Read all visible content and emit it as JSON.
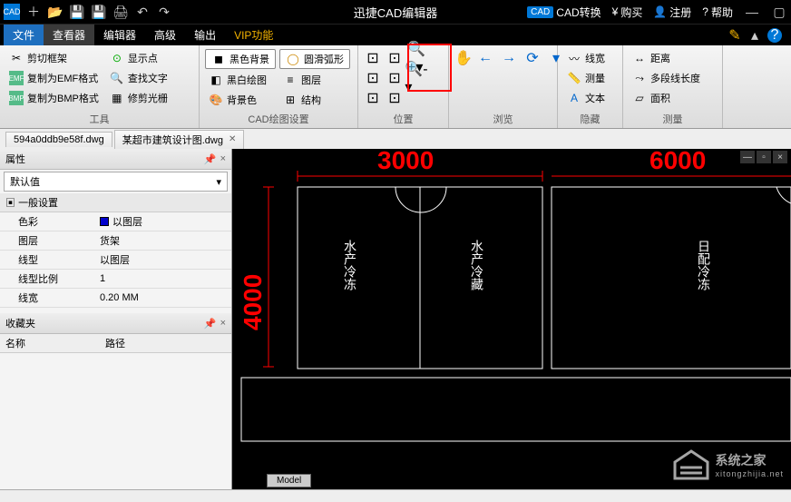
{
  "titlebar": {
    "app_title": "迅捷CAD编辑器",
    "right": {
      "convert": "CAD转换",
      "buy": "购买",
      "register": "注册",
      "help": "帮助"
    }
  },
  "menubar": {
    "tabs": [
      "文件",
      "查看器",
      "编辑器",
      "高级",
      "输出",
      "VIP功能"
    ],
    "active_index": 1
  },
  "ribbon": {
    "groups": {
      "tools": {
        "label": "工具",
        "items": [
          "剪切框架",
          "复制为EMF格式",
          "复制为BMP格式",
          "显示点",
          "查找文字",
          "修剪光栅"
        ]
      },
      "cad_draw": {
        "label": "CAD绘图设置",
        "items": [
          "黑色背景",
          "黑白绘图",
          "背景色",
          "圆滑弧形",
          "图层",
          "结构"
        ]
      },
      "position": {
        "label": "位置"
      },
      "browse": {
        "label": "浏览"
      },
      "hide": {
        "label": "隐藏",
        "items": [
          "线宽",
          "测量",
          "文本"
        ]
      },
      "measure": {
        "label": "测量",
        "items": [
          "距离",
          "多段线长度",
          "面积"
        ]
      }
    }
  },
  "file_tabs": {
    "tab1": "594a0ddb9e58f.dwg",
    "tab2": "某超市建筑设计图.dwg"
  },
  "props": {
    "title": "属性",
    "default_value": "默认值",
    "section": "一般设置",
    "rows": {
      "color_k": "色彩",
      "color_v": "以图层",
      "layer_k": "图层",
      "layer_v": "货架",
      "ltype_k": "线型",
      "ltype_v": "以图层",
      "lscale_k": "线型比例",
      "lscale_v": "1",
      "lwidth_k": "线宽",
      "lwidth_v": "0.20 MM"
    },
    "favorites": "收藏夹",
    "fav_cols": {
      "name": "名称",
      "path": "路径"
    }
  },
  "drawing": {
    "dims": {
      "top1": "3000",
      "top2": "6000",
      "left": "4000"
    },
    "rooms": {
      "r1": "水产冷冻",
      "r2": "水产冷藏",
      "r3": "日配冷冻"
    },
    "model_tab": "Model"
  },
  "watermark": {
    "text": "系统之家",
    "sub": "xitongzhijia.net"
  }
}
